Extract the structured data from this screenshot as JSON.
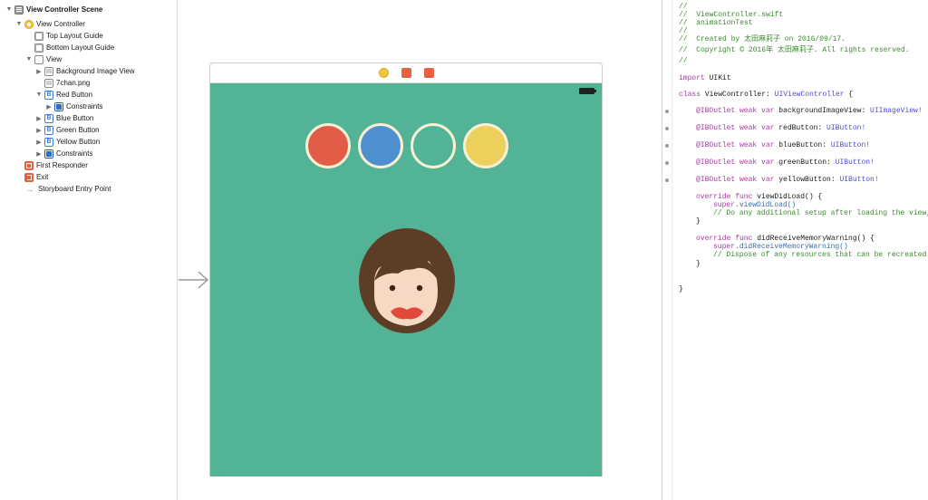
{
  "outline": {
    "scene_title": "View Controller Scene",
    "view_controller": "View Controller",
    "top_layout_guide": "Top Layout Guide",
    "bottom_layout_guide": "Bottom Layout Guide",
    "view": "View",
    "background_image_view": "Background Image View",
    "image_file": "7chan.png",
    "red_button": "Red Button",
    "constraints": "Constraints",
    "blue_button": "Blue Button",
    "green_button": "Green Button",
    "yellow_button": "Yellow Button",
    "view_constraints": "Constraints",
    "first_responder": "First Responder",
    "exit": "Exit",
    "storyboard_entry": "Storyboard Entry Point"
  },
  "canvas": {
    "background_color": "#52b396",
    "button_colors": {
      "red": "#e15d48",
      "blue": "#4e8fd0",
      "green": "#52b396",
      "yellow": "#ecd05b"
    }
  },
  "code": {
    "lines": [
      "//",
      "//  ViewController.swift",
      "//  animationTest",
      "//",
      "//  Created by 太田麻莉子 on 2016/09/17.",
      "//  Copyright © 2016年 太田麻莉子. All rights reserved.",
      "//"
    ],
    "import_kw": "import",
    "import_mod": "UIKit",
    "class_kw": "class",
    "class_decl": " ViewController: ",
    "class_super": "UIViewController",
    "class_brace": " {",
    "outlets": [
      {
        "name": "backgroundImageView",
        "type": "UIImageView!"
      },
      {
        "name": "redButton",
        "type": "UIButton!"
      },
      {
        "name": "blueButton",
        "type": "UIButton!"
      },
      {
        "name": "greenButton",
        "type": "UIButton!"
      },
      {
        "name": "yellowButton",
        "type": "UIButton!"
      }
    ],
    "outlet_prefix": "@IBOutlet weak var ",
    "override_func": "override func",
    "view_did_load_sig": " viewDidLoad() {",
    "super_kw": "super",
    "view_did_load_call": ".viewDidLoad()",
    "view_did_load_comment": "// Do any additional setup after loading the view, typically from a nib.",
    "close_brace": "}",
    "memory_sig": " didReceiveMemoryWarning() {",
    "memory_call": ".didReceiveMemoryWarning()",
    "memory_comment": "// Dispose of any resources that can be recreated.",
    "final_brace": "}"
  }
}
